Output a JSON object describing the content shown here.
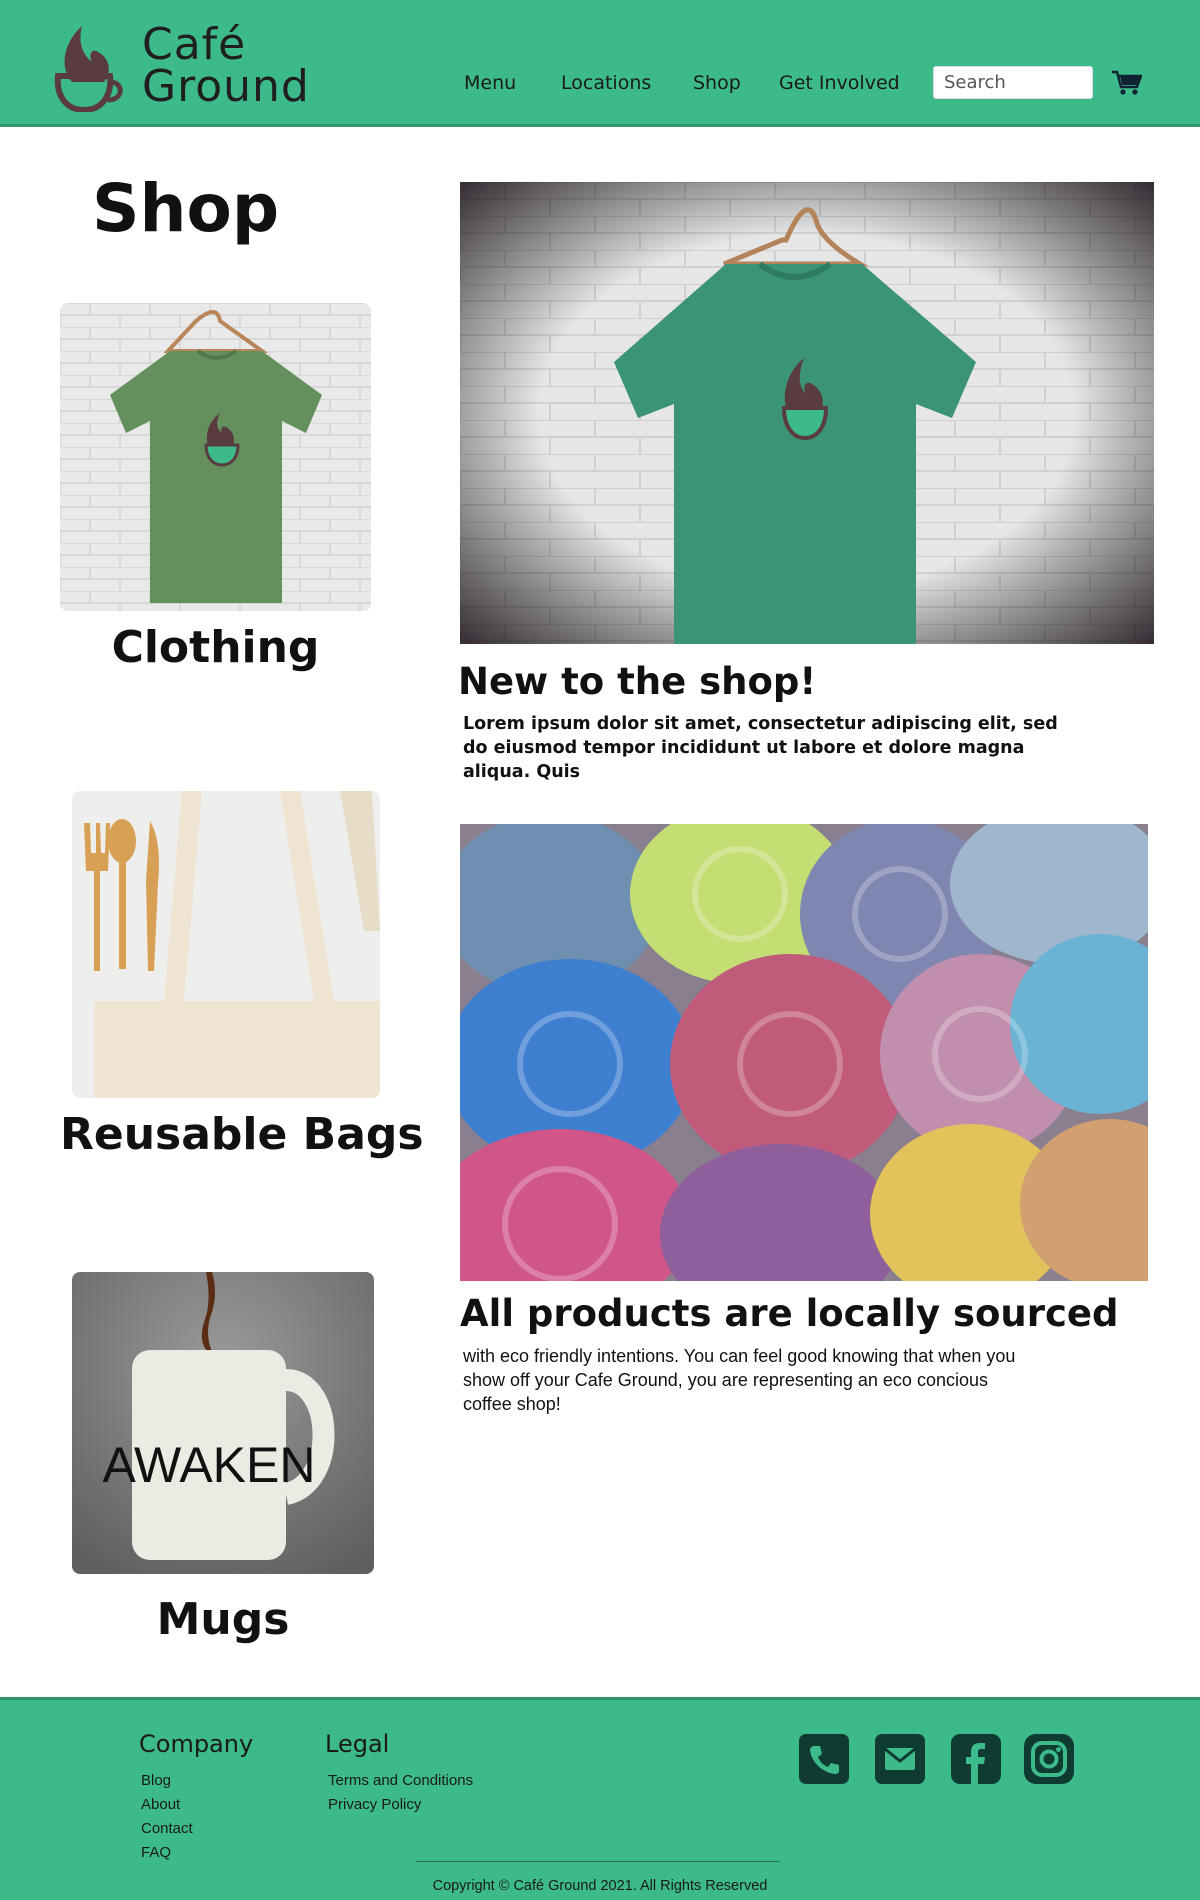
{
  "brand": {
    "line1": "Café",
    "line2": "Ground"
  },
  "nav": {
    "menu": "Menu",
    "locations": "Locations",
    "shop": "Shop",
    "get_involved": "Get Involved"
  },
  "search": {
    "placeholder": "Search"
  },
  "page": {
    "title": "Shop"
  },
  "categories": [
    {
      "label": "Clothing"
    },
    {
      "label": "Reusable Bags"
    },
    {
      "label": "Mugs"
    }
  ],
  "features": [
    {
      "title": "New to the shop!",
      "text": "Lorem ipsum dolor sit amet, consectetur adipiscing elit, sed do eiusmod tempor incididunt ut labore et dolore magna aliqua. Quis"
    },
    {
      "title": "All products are locally sourced",
      "text": "with eco friendly intentions. You can feel good knowing that when you show off your Cafe Ground, you are representing an eco concious coffee shop!"
    }
  ],
  "mug_text": "AWAKEN",
  "footer": {
    "company_heading": "Company",
    "company_links": [
      "Blog",
      "About",
      "Contact",
      "FAQ"
    ],
    "legal_heading": "Legal",
    "legal_links": [
      "Terms and Conditions",
      "Privacy Policy"
    ],
    "copyright": "Copyright © Café Ground 2021. All Rights Reserved"
  },
  "colors": {
    "brand_green": "#3dba8a",
    "logo_brown": "#5a3b3f",
    "icon_dark": "#0f3b33"
  },
  "icons": [
    "cart-icon",
    "phone-icon",
    "email-icon",
    "facebook-icon",
    "instagram-icon"
  ]
}
